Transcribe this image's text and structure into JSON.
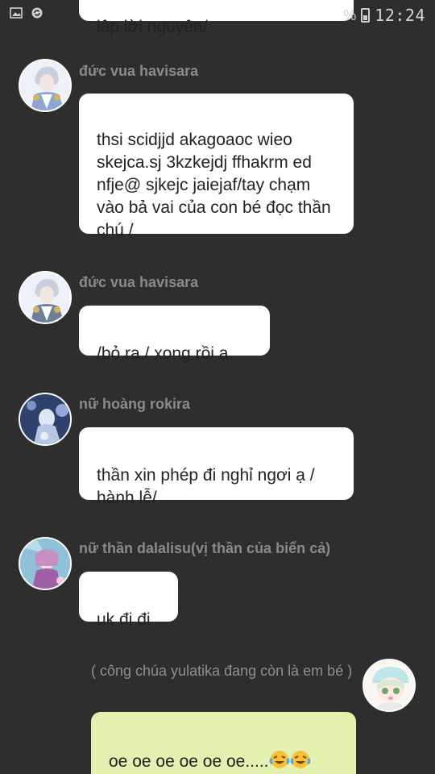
{
  "status_bar": {
    "left_icons": [
      "image-icon",
      "sync-icon"
    ],
    "battery_suffix": "%",
    "time": "12:24"
  },
  "messages": [
    {
      "text": "lập lời nguyện/"
    },
    {
      "sender": "đức vua havisara",
      "text": "thsi scidjjd akagoaoc wieo skejca.sj 3kzkejdj ffhakrm ed nfje@ sjkejc jaiejaf/tay chạm vào bả vai của con bé đọc thần chú /"
    },
    {
      "sender": "đức vua havisara",
      "text": "/bỏ ra / xong rồi ạ"
    },
    {
      "sender": "nữ hoàng rokira",
      "text": "thần xin phép đi nghỉ ngơi ạ / hành lễ/"
    },
    {
      "sender": "nữ thần dalalisu(vị thần của biển cả)",
      "text": "uk đi đi"
    },
    {
      "sender": "( công chúa yulatika đang còn là em bé )",
      "text": "oe oe oe oe oe oe....."
    }
  ],
  "emoji_icon": "crying-laughing-emoji",
  "colors": {
    "background": "#2e2e2e",
    "bubble": "#ffffff",
    "my_bubble": "#e3f0b0",
    "name_text": "#8a8a8a"
  }
}
